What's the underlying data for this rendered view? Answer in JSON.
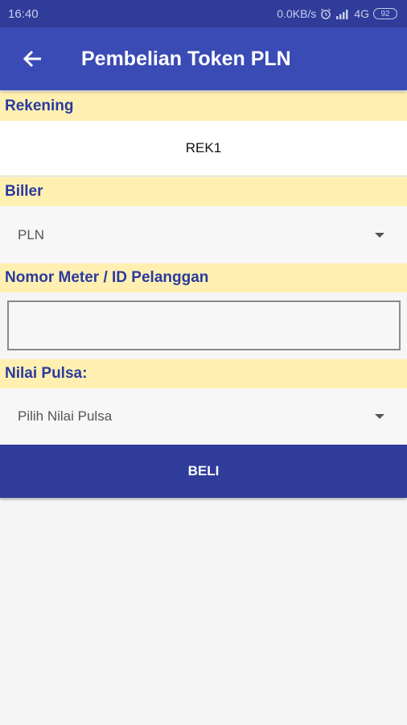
{
  "status_bar": {
    "time": "16:40",
    "net_speed": "0.0KB/s",
    "network": "4G",
    "battery": "92"
  },
  "app_bar": {
    "title": "Pembelian Token PLN"
  },
  "form": {
    "rekening_label": "Rekening",
    "rekening_value": "REK1",
    "biller_label": "Biller",
    "biller_value": "PLN",
    "meter_label": "Nomor Meter / ID Pelanggan",
    "meter_value": "",
    "nilai_label": "Nilai Pulsa:",
    "nilai_value": "Pilih Nilai Pulsa",
    "buy_label": "BELI"
  },
  "colors": {
    "status_bar": "#2f3c9a",
    "app_bar": "#3a4bb5",
    "label_bg": "#fff0b2",
    "label_text": "#2a3a9e",
    "button": "#2f3c9a"
  },
  "icons": {
    "back": "arrow-left-icon",
    "dropdown": "caret-down-icon",
    "alarm": "alarm-icon",
    "signal": "signal-icon"
  }
}
